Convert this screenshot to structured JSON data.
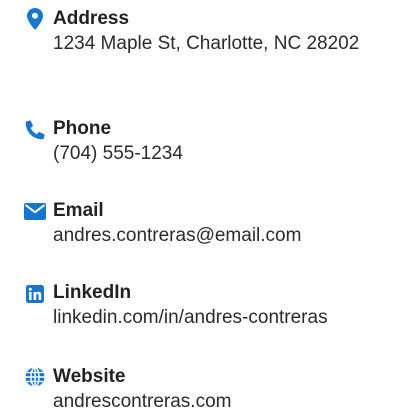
{
  "accent_color": "#1676d2",
  "contacts": [
    {
      "icon": "map-marker-icon",
      "title": "Address",
      "value": "1234 Maple St, Charlotte, NC 28202"
    },
    {
      "icon": "phone-icon",
      "title": "Phone",
      "value": "(704) 555-1234"
    },
    {
      "icon": "envelope-icon",
      "title": "Email",
      "value": "andres.contreras@email.com"
    },
    {
      "icon": "linkedin-icon",
      "title": "LinkedIn",
      "value": "linkedin.com/in/andres-contreras"
    },
    {
      "icon": "globe-icon",
      "title": "Website",
      "value": "andrescontreras.com"
    }
  ]
}
